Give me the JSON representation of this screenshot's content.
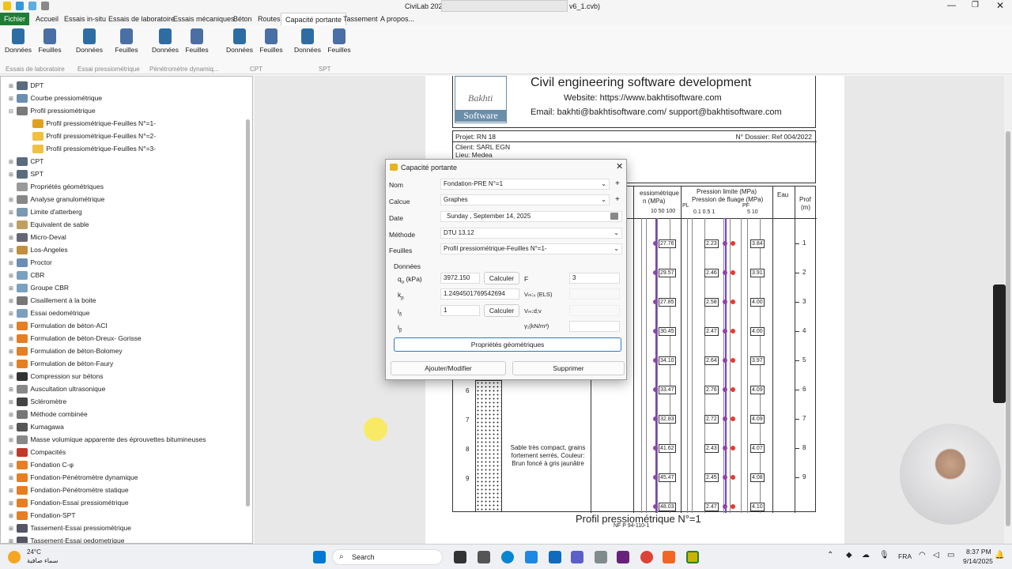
{
  "window": {
    "app_title": "CiviLab 202",
    "file_title": "v6_1.cvb)"
  },
  "menu": {
    "items": [
      "Fichier",
      "Accueil",
      "Essais in-situ",
      "Essais de laboratoire",
      "Essais mécaniques",
      "Béton",
      "Routes",
      "Capacité portante",
      "Tassement",
      "A propos..."
    ]
  },
  "ribbon": {
    "buttons": [
      "Données",
      "Feuilles",
      "Données",
      "Feuilles",
      "Données",
      "Feuilles",
      "Données",
      "Feuilles",
      "Données",
      "Feuilles"
    ],
    "groups": [
      "Essais de laboratoire",
      "Essai pressiométrique",
      "Pénétromètre dynamiq...",
      "CPT",
      "SPT"
    ]
  },
  "tree": {
    "items": [
      {
        "label": "DPT"
      },
      {
        "label": "Courbe pressiométrique"
      },
      {
        "label": "Profil pressiométrique"
      },
      {
        "label": "Profil pressiométrique-Feuilles N°=1-"
      },
      {
        "label": "Profil pressiométrique-Feuilles N°=2-"
      },
      {
        "label": "Profil pressiométrique-Feuilles N°=3-"
      },
      {
        "label": "CPT"
      },
      {
        "label": "SPT"
      },
      {
        "label": "Propriétés géométriques"
      },
      {
        "label": "Analyse granulométrique"
      },
      {
        "label": "Limite d'atterberg"
      },
      {
        "label": "Equivalent de sable"
      },
      {
        "label": "Micro-Deval"
      },
      {
        "label": "Los-Angeles"
      },
      {
        "label": "Proctor"
      },
      {
        "label": "CBR"
      },
      {
        "label": "Groupe CBR"
      },
      {
        "label": "Cisaillement à la boite"
      },
      {
        "label": "Essai oedométrique"
      },
      {
        "label": "Formulation de béton-ACI"
      },
      {
        "label": "Formulation de béton-Dreux- Gorisse"
      },
      {
        "label": "Formulation de béton-Bolomey"
      },
      {
        "label": "Formulation de béton-Faury"
      },
      {
        "label": "Compression sur bétons"
      },
      {
        "label": "Auscultation ultrasonique"
      },
      {
        "label": "Scléromètre"
      },
      {
        "label": "Méthode combinée"
      },
      {
        "label": "Kumagawa"
      },
      {
        "label": "Masse volumique apparente des éprouvettes bitumineuses"
      },
      {
        "label": "Compacités"
      },
      {
        "label": "Fondation C-φ"
      },
      {
        "label": "Fondation-Pénétromètre dynamique"
      },
      {
        "label": "Fondation-Pénétromètre statique"
      },
      {
        "label": "Fondation-Essai pressiométrique"
      },
      {
        "label": "Fondation-SPT"
      },
      {
        "label": "Tassement-Essai pressiométrique"
      },
      {
        "label": "Tassement-Essai oedometrique"
      }
    ]
  },
  "doc": {
    "header_title": "Civil engineering software development",
    "website": "Website: https://www.bakhtisoftware.com",
    "email": "Email: bakhti@bakhtisoftware.com/ support@bakhtisoftware.com",
    "logo_text1": "Bakhti",
    "logo_text2": "Software",
    "projet": "Projet: RN 18",
    "dossier": "N° Dossier: Ref 004/2022",
    "client": "Client: SARL EGN",
    "lieu": "Lieu: Medea",
    "col_pressio": "essiométrique",
    "col_pressio2": "n (MPa)",
    "col_pl_title1": "Pression limite (MPa)",
    "col_pl_title2": "Pression de fluage (MPa)",
    "pl_label": "PL",
    "pf_label": "PF",
    "pl_ticks": "0.1       0.5  1",
    "pf_ticks": "5  10",
    "em_ticks": "10         50 100",
    "eau": "Eau",
    "prof": "Prof",
    "prof_unit": "(m)",
    "soil_desc": "Sable très compact, grains fortement serrés, Couleur: Brun foncé à gris jaunâtre",
    "footer_title": "Profil pressiométrique N°=1",
    "footer_norm": "NF P 94-110-1",
    "em_values": [
      "27.76",
      "29.57",
      "27.85",
      "30.45",
      "34.10",
      "33.47",
      "32.83",
      "41.62",
      "45.47",
      "48.03"
    ],
    "pl_values": [
      "2.23",
      "2.46",
      "2.58",
      "2.47",
      "2.64",
      "2.76",
      "2.72",
      "2.43",
      "2.45",
      "2.47"
    ],
    "pf_values": [
      "3.84",
      "3.91",
      "4.00",
      "4.00",
      "3.97",
      "4.09",
      "4.09",
      "4.07",
      "4.08",
      "4.10"
    ],
    "depths": [
      "1",
      "2",
      "3",
      "4",
      "5",
      "6",
      "7",
      "8",
      "9"
    ],
    "left_depths": [
      "6",
      "7",
      "8",
      "9"
    ]
  },
  "dialog": {
    "title": "Capacité portante",
    "nom_label": "Nom",
    "nom_value": "Fondation-PRE N°=1",
    "calcul_label": "Calcue",
    "calcul_value": "Graphes",
    "date_label": "Date",
    "date_value": "Sunday    , September 14, 2025",
    "methode_label": "Méthode",
    "methode_value": "DTU 13.12",
    "feuilles_label": "Feuilles",
    "feuilles_value": "Profil pressiométrique-Feuilles N°=1-",
    "donnees_label": "Données",
    "qu_label": "q",
    "qu_unit": "(kPa)",
    "qu_value": "3972.150",
    "kp_label": "k",
    "kp_value": "1.2494501769542694",
    "ie_label": "i",
    "ie_value": "1",
    "ib_label": "i",
    "f_label": "F",
    "f_value": "3",
    "qels_label": "Vₘ:ᵥ (ELS)",
    "qdv_label": "Vₘ:d;v",
    "gamma_label": "γ₁(kN/m³)",
    "calc_btn": "Calculer",
    "calc_btn2": "Calculer",
    "geo_btn": "Propriétés géométriques",
    "add_btn": "Ajouter/Modifier",
    "del_btn": "Supprimer",
    "plus": "+"
  },
  "taskbar": {
    "weather_temp": "24°C",
    "weather_desc": "سماء صافية",
    "search": "Search",
    "lang": "FRA",
    "time": "8:37 PM",
    "date": "9/14/2025"
  },
  "colors": {
    "accent": "#2b579a",
    "fichier": "#1e7e34",
    "purple": "#8e44ad",
    "red": "#e53935"
  }
}
